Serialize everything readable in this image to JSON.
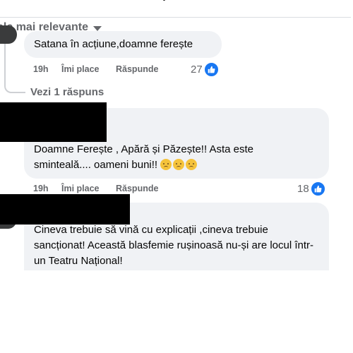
{
  "sort": {
    "label": "ele mai relevante",
    "icon": "caret-down-icon"
  },
  "comments": [
    {
      "text": "Satana în acțiune,doamne ferește",
      "time": "19h",
      "like_label": "Îmi place",
      "reply_label": "Răspunde",
      "reaction_count": "27"
    },
    {
      "text": "Doamne Ferește , Apără și Păzește!! Asta este sminteală.... oameni buni!!",
      "time": "19h",
      "like_label": "Îmi place",
      "reply_label": "Răspunde",
      "reaction_count": "18",
      "emoji": [
        "sad-face",
        "sad-face",
        "sad-face"
      ]
    },
    {
      "text": "Cineva trebuie să vină cu explicații ,cineva trebuie sancționat! Această blasfemie rușinoasă nu-și are locul într-un Teatru Național!"
    }
  ],
  "replies_link": "Vezi 1 răspuns",
  "colors": {
    "bubble": "#f0f2f5",
    "meta": "#65676b",
    "like_badge": "#1877f2",
    "redaction": "#000000"
  }
}
